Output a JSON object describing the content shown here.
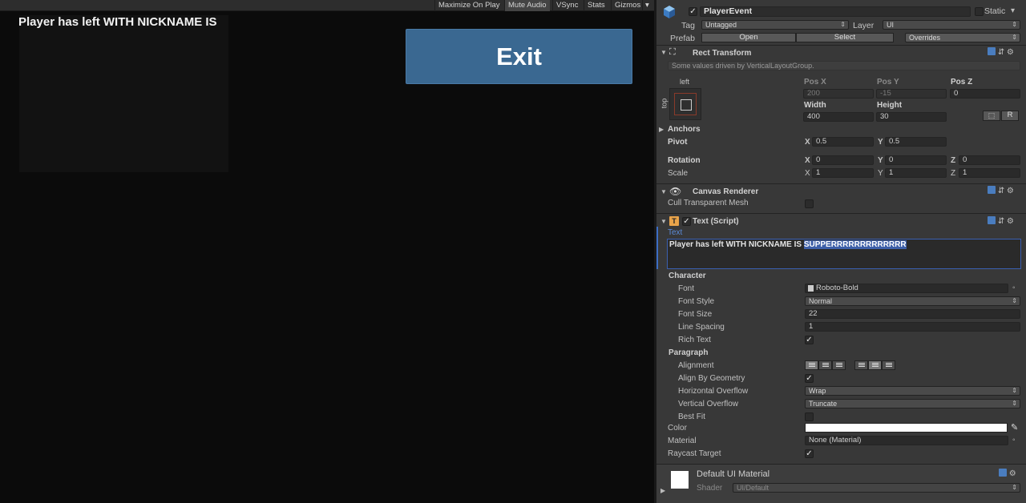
{
  "game_view": {
    "toolbar": [
      "Maximize On Play",
      "Mute Audio",
      "VSync",
      "Stats",
      "Gizmos"
    ],
    "player_text": "Player has left WITH NICKNAME IS",
    "exit_label": "Exit"
  },
  "inspector": {
    "object_name": "PlayerEvent",
    "static_label": "Static",
    "tag_label": "Tag",
    "tag_value": "Untagged",
    "layer_label": "Layer",
    "layer_value": "UI",
    "prefab_label": "Prefab",
    "prefab_open": "Open",
    "prefab_select": "Select",
    "prefab_overrides": "Overrides",
    "rect_transform": {
      "title": "Rect Transform",
      "driven_note": "Some values driven by VerticalLayoutGroup.",
      "anchor_h": "left",
      "anchor_v": "top",
      "pos_x_label": "Pos X",
      "pos_y_label": "Pos Y",
      "pos_z_label": "Pos Z",
      "pos_x": "200",
      "pos_y": "-15",
      "pos_z": "0",
      "width_label": "Width",
      "height_label": "Height",
      "width": "400",
      "height": "30",
      "r_label": "R",
      "anchors_label": "Anchors",
      "pivot_label": "Pivot",
      "pivot_x": "0.5",
      "pivot_y": "0.5",
      "rotation_label": "Rotation",
      "rot_x": "0",
      "rot_y": "0",
      "rot_z": "0",
      "scale_label": "Scale",
      "scale_x": "1",
      "scale_y": "1",
      "scale_z": "1",
      "x": "X",
      "y": "Y",
      "z": "Z"
    },
    "canvas_renderer": {
      "title": "Canvas Renderer",
      "cull_label": "Cull Transparent Mesh"
    },
    "text_script": {
      "title": "Text (Script)",
      "text_label": "Text",
      "text_value_plain": "Player has left WITH NICKNAME IS ",
      "text_value_selected": "SUPPERRRRRRRRRRRRR",
      "character_label": "Character",
      "font_label": "Font",
      "font_value": "Roboto-Bold",
      "font_style_label": "Font Style",
      "font_style_value": "Normal",
      "font_size_label": "Font Size",
      "font_size_value": "22",
      "line_spacing_label": "Line Spacing",
      "line_spacing_value": "1",
      "rich_text_label": "Rich Text",
      "paragraph_label": "Paragraph",
      "alignment_label": "Alignment",
      "align_geom_label": "Align By Geometry",
      "h_overflow_label": "Horizontal Overflow",
      "h_overflow_value": "Wrap",
      "v_overflow_label": "Vertical Overflow",
      "v_overflow_value": "Truncate",
      "best_fit_label": "Best Fit",
      "color_label": "Color",
      "color_value": "#ffffff",
      "material_label": "Material",
      "material_value": "None (Material)",
      "raycast_label": "Raycast Target"
    },
    "material": {
      "name": "Default UI Material",
      "shader_label": "Shader",
      "shader_value": "UI/Default"
    }
  },
  "colors": {
    "exit_button": "#3a6891",
    "selection": "#3d5fa8",
    "inspector_bg": "#383838"
  }
}
